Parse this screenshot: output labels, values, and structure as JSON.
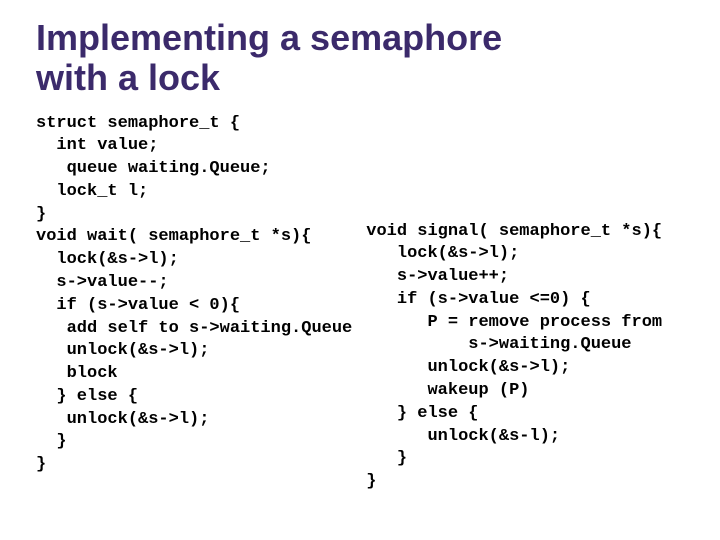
{
  "title_line1": "Implementing a semaphore",
  "title_line2": "with a lock",
  "code_left": "struct semaphore_t {\n  int value;\n   queue waiting.Queue;\n  lock_t l;\n}\nvoid wait( semaphore_t *s){\n  lock(&s->l);\n  s->value--;\n  if (s->value < 0){\n   add self to s->waiting.Queue\n   unlock(&s->l);\n   block\n  } else {\n   unlock(&s->l);\n  }\n}",
  "code_right": "void signal( semaphore_t *s){\n   lock(&s->l);\n   s->value++;\n   if (s->value <=0) {\n      P = remove process from\n          s->waiting.Queue\n      unlock(&s->l);\n      wakeup (P)\n   } else {\n      unlock(&s-l);\n   }\n}"
}
